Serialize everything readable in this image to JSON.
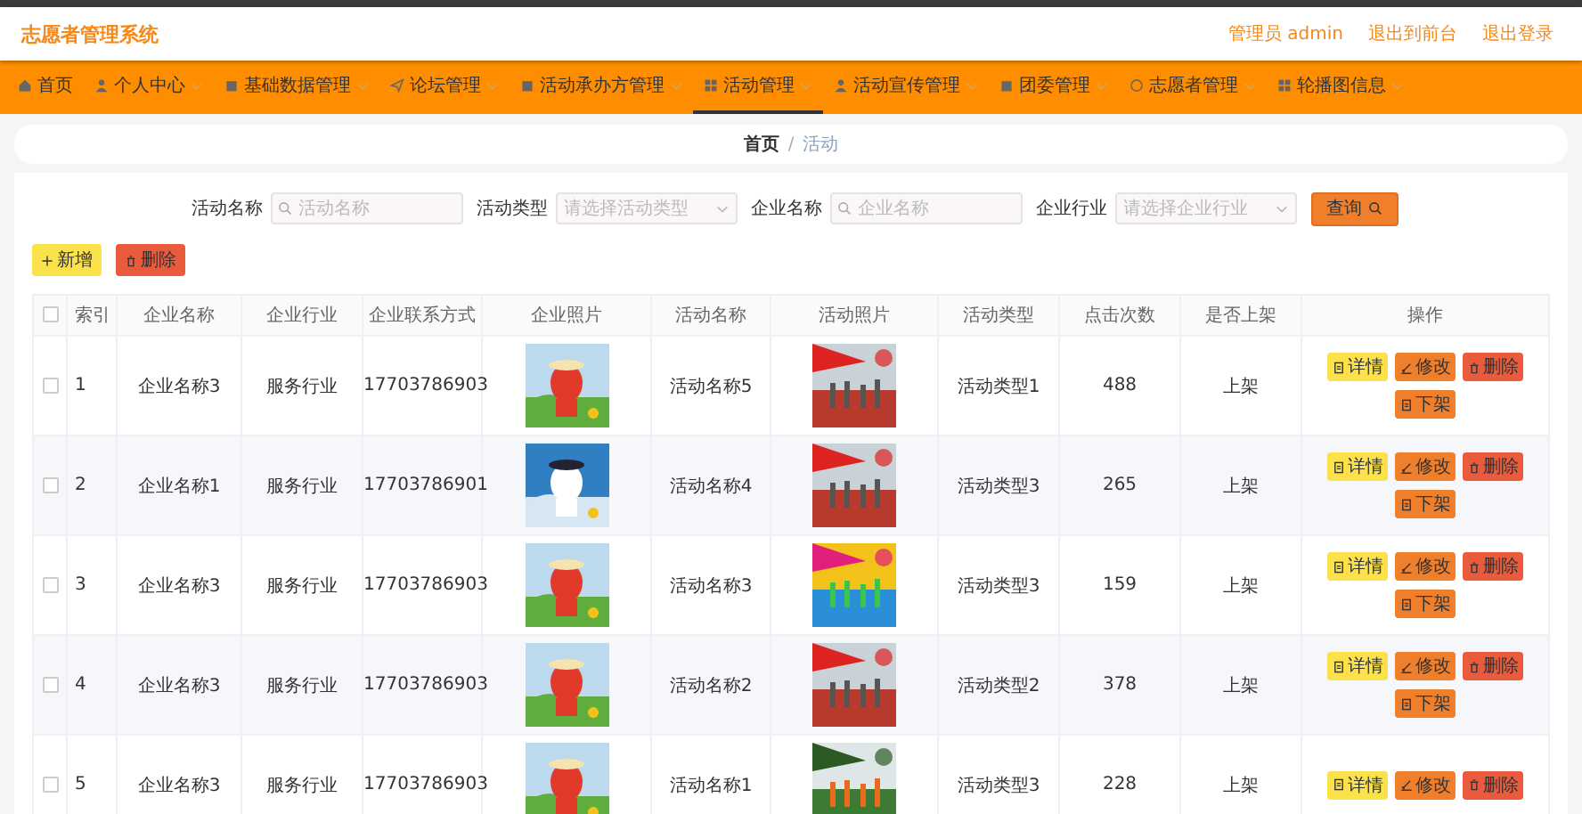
{
  "header": {
    "title": "志愿者管理系统",
    "links": [
      "管理员 admin",
      "退出到前台",
      "退出登录"
    ]
  },
  "nav": [
    {
      "label": "首页",
      "selected": false,
      "dropdown": false
    },
    {
      "label": "个人中心",
      "selected": false,
      "dropdown": true
    },
    {
      "label": "基础数据管理",
      "selected": false,
      "dropdown": true
    },
    {
      "label": "论坛管理",
      "selected": false,
      "dropdown": true
    },
    {
      "label": "活动承办方管理",
      "selected": false,
      "dropdown": true
    },
    {
      "label": "活动管理",
      "selected": true,
      "dropdown": true
    },
    {
      "label": "活动宣传管理",
      "selected": false,
      "dropdown": true
    },
    {
      "label": "团委管理",
      "selected": false,
      "dropdown": true
    },
    {
      "label": "志愿者管理",
      "selected": false,
      "dropdown": true
    },
    {
      "label": "轮播图信息",
      "selected": false,
      "dropdown": true
    }
  ],
  "breadcrumb": [
    "首页",
    "活动"
  ],
  "breadcrumb_separator": "/",
  "search": [
    {
      "label": "活动名称",
      "kind": "text",
      "placeholder": "活动名称"
    },
    {
      "label": "活动类型",
      "kind": "select",
      "placeholder": "请选择活动类型"
    },
    {
      "label": "企业名称",
      "kind": "text",
      "placeholder": "企业名称"
    },
    {
      "label": "企业行业",
      "kind": "select",
      "placeholder": "请选择企业行业"
    }
  ],
  "search_button": "查询",
  "toolbar": [
    {
      "label": "新增",
      "kind": "add"
    },
    {
      "label": "删除",
      "kind": "delete"
    }
  ],
  "table": {
    "header_checked": false,
    "columns": [
      "索引",
      "企业名称",
      "企业行业",
      "企业联系方式",
      "企业照片",
      "活动名称",
      "活动照片",
      "活动类型",
      "点击次数",
      "是否上架",
      "操作"
    ],
    "rows": [
      {
        "checked": false,
        "index": "1",
        "company": "企业名称3",
        "industry": "服务行业",
        "phone": "17703786903",
        "company_photo": {
          "kind": "picture"
        },
        "activity": "活动名称5",
        "activity_photo": {
          "kind": "picture"
        },
        "type": "活动类型1",
        "clicks": "488",
        "status": "上架",
        "actions": [
          {
            "label": "详情",
            "kind": "detail"
          },
          {
            "label": "修改",
            "kind": "edit"
          },
          {
            "label": "删除",
            "kind": "delete"
          },
          {
            "label": "下架",
            "kind": "offshelf"
          }
        ]
      },
      {
        "checked": false,
        "index": "2",
        "company": "企业名称1",
        "industry": "服务行业",
        "phone": "17703786901",
        "company_photo": {
          "kind": "picture"
        },
        "activity": "活动名称4",
        "activity_photo": {
          "kind": "picture"
        },
        "type": "活动类型3",
        "clicks": "265",
        "status": "上架",
        "actions": [
          {
            "label": "详情",
            "kind": "detail"
          },
          {
            "label": "修改",
            "kind": "edit"
          },
          {
            "label": "删除",
            "kind": "delete"
          },
          {
            "label": "下架",
            "kind": "offshelf"
          }
        ]
      },
      {
        "checked": false,
        "index": "3",
        "company": "企业名称3",
        "industry": "服务行业",
        "phone": "17703786903",
        "company_photo": {
          "kind": "picture"
        },
        "activity": "活动名称3",
        "activity_photo": {
          "kind": "picture"
        },
        "type": "活动类型3",
        "clicks": "159",
        "status": "上架",
        "actions": [
          {
            "label": "详情",
            "kind": "detail"
          },
          {
            "label": "修改",
            "kind": "edit"
          },
          {
            "label": "删除",
            "kind": "delete"
          },
          {
            "label": "下架",
            "kind": "offshelf"
          }
        ]
      },
      {
        "checked": false,
        "index": "4",
        "company": "企业名称3",
        "industry": "服务行业",
        "phone": "17703786903",
        "company_photo": {
          "kind": "picture"
        },
        "activity": "活动名称2",
        "activity_photo": {
          "kind": "picture"
        },
        "type": "活动类型2",
        "clicks": "378",
        "status": "上架",
        "actions": [
          {
            "label": "详情",
            "kind": "detail"
          },
          {
            "label": "修改",
            "kind": "edit"
          },
          {
            "label": "删除",
            "kind": "delete"
          },
          {
            "label": "下架",
            "kind": "offshelf"
          }
        ]
      },
      {
        "checked": false,
        "index": "5",
        "company": "企业名称3",
        "industry": "服务行业",
        "phone": "17703786903",
        "company_photo": {
          "kind": "picture"
        },
        "activity": "活动名称1",
        "activity_photo": {
          "kind": "picture"
        },
        "type": "活动类型3",
        "clicks": "228",
        "status": "上架",
        "actions": [
          {
            "label": "详情",
            "kind": "detail"
          },
          {
            "label": "修改",
            "kind": "edit"
          },
          {
            "label": "删除",
            "kind": "delete"
          }
        ]
      }
    ]
  }
}
